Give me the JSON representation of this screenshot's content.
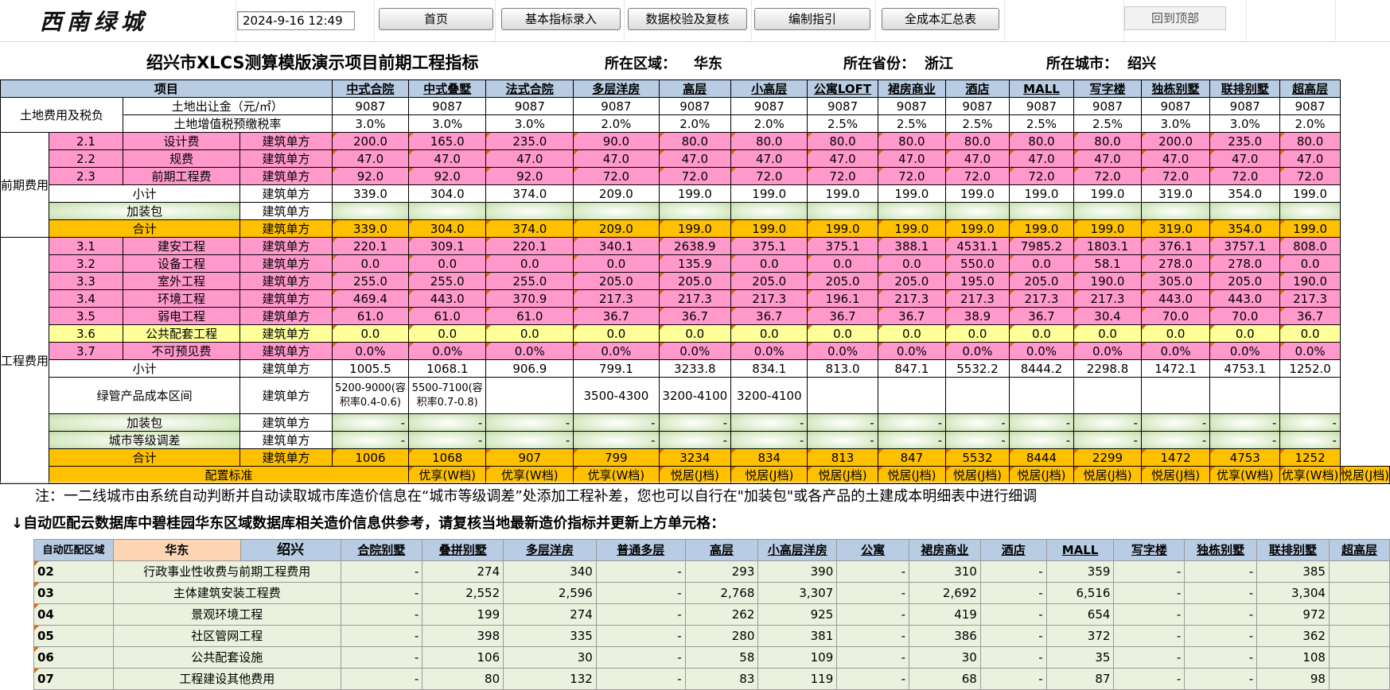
{
  "toolbar": {
    "logo": "西南绿城",
    "datetime": "2024-9-16  12:49",
    "buttons": [
      "首页",
      "基本指标录入",
      "数据校验及复核",
      "编制指引",
      "全成本汇总表"
    ],
    "top_button": "回到顶部"
  },
  "header": {
    "title": "绍兴市XLCS测算模版演示项目前期工程指标",
    "region_label": "所在区域：",
    "region": "华东",
    "province_label": "所在省份：",
    "province": "浙江",
    "city_label": "所在城市：",
    "city": "绍兴"
  },
  "table": {
    "item_header": "项目",
    "columns": [
      "中式合院",
      "中式叠墅",
      "法式合院",
      "多层洋房",
      "高层",
      "小高层",
      "公寓LOFT",
      "裙房商业",
      "酒店",
      "MALL",
      "写字楼",
      "独栋别墅",
      "联排别墅",
      "超高层"
    ],
    "land_group": "土地费用及税负",
    "land_rows": [
      {
        "label": "土地出让金（元/㎡）",
        "values": [
          "9087",
          "9087",
          "9087",
          "9087",
          "9087",
          "9087",
          "9087",
          "9087",
          "9087",
          "9087",
          "9087",
          "9087",
          "9087",
          "9087"
        ]
      },
      {
        "label": "土地增值税预缴税率",
        "values": [
          "3.0%",
          "3.0%",
          "3.0%",
          "2.0%",
          "2.0%",
          "2.0%",
          "2.5%",
          "2.5%",
          "2.5%",
          "2.5%",
          "2.5%",
          "3.0%",
          "3.0%",
          "2.0%"
        ]
      }
    ],
    "pre_group": "前期费用",
    "pre_rows": [
      {
        "no": "2.1",
        "label": "设计费",
        "unit": "建筑单方",
        "values": [
          "200.0",
          "165.0",
          "235.0",
          "90.0",
          "80.0",
          "80.0",
          "80.0",
          "80.0",
          "80.0",
          "80.0",
          "80.0",
          "200.0",
          "235.0",
          "80.0"
        ]
      },
      {
        "no": "2.2",
        "label": "规费",
        "unit": "建筑单方",
        "values": [
          "47.0",
          "47.0",
          "47.0",
          "47.0",
          "47.0",
          "47.0",
          "47.0",
          "47.0",
          "47.0",
          "47.0",
          "47.0",
          "47.0",
          "47.0",
          "47.0"
        ]
      },
      {
        "no": "2.3",
        "label": "前期工程费",
        "unit": "建筑单方",
        "values": [
          "92.0",
          "92.0",
          "92.0",
          "72.0",
          "72.0",
          "72.0",
          "72.0",
          "72.0",
          "72.0",
          "72.0",
          "72.0",
          "72.0",
          "72.0",
          "72.0"
        ]
      }
    ],
    "pre_subtotal": {
      "label": "小计",
      "unit": "建筑单方",
      "values": [
        "339.0",
        "304.0",
        "374.0",
        "209.0",
        "199.0",
        "199.0",
        "199.0",
        "199.0",
        "199.0",
        "199.0",
        "199.0",
        "319.0",
        "354.0",
        "199.0"
      ]
    },
    "pre_addon": {
      "label": "加装包",
      "unit": "建筑单方"
    },
    "pre_total": {
      "label": "合计",
      "unit": "建筑单方",
      "values": [
        "339.0",
        "304.0",
        "374.0",
        "209.0",
        "199.0",
        "199.0",
        "199.0",
        "199.0",
        "199.0",
        "199.0",
        "199.0",
        "319.0",
        "354.0",
        "199.0"
      ]
    },
    "eng_group": "工程费用",
    "eng_rows": [
      {
        "no": "3.1",
        "label": "建安工程",
        "unit": "建筑单方",
        "values": [
          "220.1",
          "309.1",
          "220.1",
          "340.1",
          "2638.9",
          "375.1",
          "375.1",
          "388.1",
          "4531.1",
          "7985.2",
          "1803.1",
          "376.1",
          "3757.1",
          "808.0"
        ]
      },
      {
        "no": "3.2",
        "label": "设备工程",
        "unit": "建筑单方",
        "values": [
          "0.0",
          "0.0",
          "0.0",
          "0.0",
          "135.9",
          "0.0",
          "0.0",
          "0.0",
          "550.0",
          "0.0",
          "58.1",
          "278.0",
          "278.0",
          "0.0"
        ]
      },
      {
        "no": "3.3",
        "label": "室外工程",
        "unit": "建筑单方",
        "values": [
          "255.0",
          "255.0",
          "255.0",
          "205.0",
          "205.0",
          "205.0",
          "205.0",
          "205.0",
          "195.0",
          "205.0",
          "190.0",
          "305.0",
          "205.0",
          "190.0"
        ]
      },
      {
        "no": "3.4",
        "label": "环境工程",
        "unit": "建筑单方",
        "values": [
          "469.4",
          "443.0",
          "370.9",
          "217.3",
          "217.3",
          "217.3",
          "196.1",
          "217.3",
          "217.3",
          "217.3",
          "217.3",
          "443.0",
          "443.0",
          "217.3"
        ]
      },
      {
        "no": "3.5",
        "label": "弱电工程",
        "unit": "建筑单方",
        "values": [
          "61.0",
          "61.0",
          "61.0",
          "36.7",
          "36.7",
          "36.7",
          "36.7",
          "36.7",
          "38.9",
          "36.7",
          "30.4",
          "70.0",
          "70.0",
          "36.7"
        ]
      },
      {
        "no": "3.6",
        "label": "公共配套工程",
        "unit": "建筑单方",
        "values": [
          "0.0",
          "0.0",
          "0.0",
          "0.0",
          "0.0",
          "0.0",
          "0.0",
          "0.0",
          "0.0",
          "0.0",
          "0.0",
          "0.0",
          "0.0",
          "0.0"
        ]
      },
      {
        "no": "3.7",
        "label": "不可预见费",
        "unit": "建筑单方",
        "values": [
          "0.0%",
          "0.0%",
          "0.0%",
          "0.0%",
          "0.0%",
          "0.0%",
          "0.0%",
          "0.0%",
          "0.0%",
          "0.0%",
          "0.0%",
          "0.0%",
          "0.0%",
          "0.0%"
        ]
      }
    ],
    "eng_subtotal": {
      "label": "小计",
      "unit": "建筑单方",
      "values": [
        "1005.5",
        "1068.1",
        "906.9",
        "799.1",
        "3233.8",
        "834.1",
        "813.0",
        "847.1",
        "5532.2",
        "8444.2",
        "2298.8",
        "1472.1",
        "4753.1",
        "1252.0"
      ]
    },
    "green_range": {
      "label": "绿管产品成本区间",
      "unit": "建筑单方",
      "values": [
        "5200-9000(容积率0.4-0.6)",
        "5500-7100(容积率0.7-0.8)",
        "",
        "3500-4300",
        "3200-4100",
        "3200-4100",
        "",
        "",
        "",
        "",
        "",
        "",
        "",
        ""
      ]
    },
    "eng_addon": {
      "label": "加装包",
      "unit": "建筑单方",
      "values": [
        "-",
        "-",
        "-",
        "-",
        "-",
        "-",
        "-",
        "-",
        "-",
        "-",
        "-",
        "-",
        "-",
        "-"
      ]
    },
    "city_adjust": {
      "label": "城市等级调差",
      "unit": "建筑单方",
      "values": [
        "-",
        "-",
        "-",
        "-",
        "-",
        "-",
        "-",
        "-",
        "-",
        "-",
        "-",
        "-",
        "-",
        "-"
      ]
    },
    "eng_total": {
      "label": "合计",
      "unit": "建筑单方",
      "values": [
        "1006",
        "1068",
        "907",
        "799",
        "3234",
        "834",
        "813",
        "847",
        "5532",
        "8444",
        "2299",
        "1472",
        "4753",
        "1252"
      ]
    },
    "config": {
      "label": "配置标准",
      "values": [
        "优享(W档)",
        "优享(W档)",
        "优享(W档)",
        "悦居(J档)",
        "悦居(J档)",
        "悦居(J档)",
        "悦居(J档)",
        "悦居(J档)",
        "悦居(J档)",
        "悦居(J档)",
        "悦居(J档)",
        "优享(W档)",
        "优享(W档)",
        "悦居(J档)"
      ]
    }
  },
  "note": "注：一二线城市由系统自动判断并自动读取城市库造价信息在“城市等级调差”处添加工程补差，您也可以自行在\"加装包\"或各产品的土建成本明细表中进行细调",
  "ref_title": "↓自动匹配云数据库中碧桂园华东区域数据库相关造价信息供参考，请复核当地最新造价指标并更新上方单元格：",
  "ref": {
    "match_label": "自动匹配区域",
    "region": "华东",
    "city": "绍兴",
    "columns": [
      "合院别墅",
      "叠拼别墅",
      "多层洋房",
      "普通多层",
      "高层",
      "小高层洋房",
      "公寓",
      "裙房商业",
      "酒店",
      "MALL",
      "写字楼",
      "独栋别墅",
      "联排别墅",
      "超高层"
    ],
    "rows": [
      {
        "code": "02",
        "name": "行政事业性收费与前期工程费用",
        "values": [
          "-",
          "274",
          "340",
          "-",
          "293",
          "390",
          "-",
          "310",
          "-",
          "359",
          "-",
          "-",
          "385",
          ""
        ]
      },
      {
        "code": "03",
        "name": "主体建筑安装工程费",
        "values": [
          "-",
          "2,552",
          "2,596",
          "-",
          "2,768",
          "3,307",
          "-",
          "2,692",
          "-",
          "6,516",
          "-",
          "-",
          "3,304",
          ""
        ]
      },
      {
        "code": "04",
        "name": "景观环境工程",
        "values": [
          "-",
          "199",
          "274",
          "-",
          "262",
          "925",
          "-",
          "419",
          "-",
          "654",
          "-",
          "-",
          "972",
          ""
        ]
      },
      {
        "code": "05",
        "name": "社区管网工程",
        "values": [
          "-",
          "398",
          "335",
          "-",
          "280",
          "381",
          "-",
          "386",
          "-",
          "372",
          "-",
          "-",
          "362",
          ""
        ]
      },
      {
        "code": "06",
        "name": "公共配套设施",
        "values": [
          "-",
          "106",
          "30",
          "-",
          "58",
          "109",
          "-",
          "30",
          "-",
          "35",
          "-",
          "-",
          "108",
          ""
        ]
      },
      {
        "code": "07",
        "name": "工程建设其他费用",
        "values": [
          "-",
          "80",
          "132",
          "-",
          "83",
          "119",
          "-",
          "68",
          "-",
          "87",
          "-",
          "-",
          "98",
          ""
        ]
      }
    ]
  }
}
